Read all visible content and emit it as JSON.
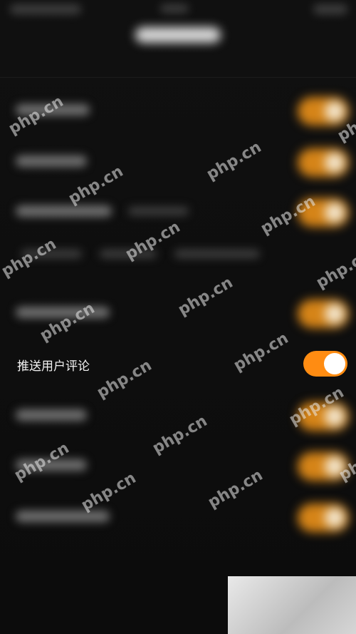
{
  "settings": {
    "visible_row_label": "推送用户评论",
    "visible_row_toggle_state": "on"
  },
  "watermark": {
    "text": "php.cn"
  },
  "colors": {
    "toggle_on": "#ff8c12",
    "background": "#0d0d0d",
    "text": "#f2f2f2"
  }
}
